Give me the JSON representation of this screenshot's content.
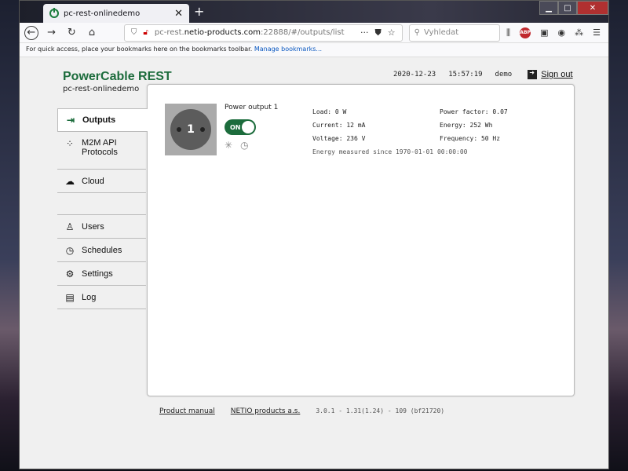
{
  "browser": {
    "tab_title": "pc-rest-onlinedemo",
    "tab_close": "✕",
    "new_tab": "+",
    "url_prefix": "pc-rest.",
    "url_domain": "netio-products.com",
    "url_rest": ":22888/#/outputs/list",
    "url_more": "···",
    "search_placeholder": "Vyhledat",
    "bookmarks_text": "For quick access, place your bookmarks here on the bookmarks toolbar.",
    "bookmarks_link": "Manage bookmarks...",
    "abp": "ABP"
  },
  "header": {
    "brand": "PowerCable REST",
    "device_name": "pc-rest-onlinedemo",
    "date": "2020-12-23",
    "time": "15:57:19",
    "user": "demo",
    "sign_out": "Sign out"
  },
  "sidebar": {
    "items": [
      {
        "label": "Outputs",
        "icon": "arrow-right-icon"
      },
      {
        "label": "M2M API",
        "label2": "Protocols",
        "icon": "nodes-icon"
      },
      {
        "label": "Cloud",
        "icon": "cloud-icon"
      },
      {
        "label": "Users",
        "icon": "user-icon"
      },
      {
        "label": "Schedules",
        "icon": "clock-icon"
      },
      {
        "label": "Settings",
        "icon": "gear-icon"
      },
      {
        "label": "Log",
        "icon": "log-icon"
      }
    ]
  },
  "output": {
    "number": "1",
    "name": "Power output 1",
    "state": "ON",
    "load": "Load: 0 W",
    "current": "Current: 12 mA",
    "voltage": "Voltage: 236 V",
    "power_factor": "Power factor: 0.07",
    "energy": "Energy: 252 Wh",
    "frequency": "Frequency: 50 Hz",
    "energy_since": "Energy measured since 1970-01-01 00:00:00"
  },
  "footer": {
    "manual": "Product manual",
    "company": "NETIO products a.s.",
    "version": "3.0.1 - 1.31(1.24) - 109 (bf21720)"
  },
  "colors": {
    "brand": "#1c6c3c",
    "toggle_on": "#1c6c3c"
  }
}
